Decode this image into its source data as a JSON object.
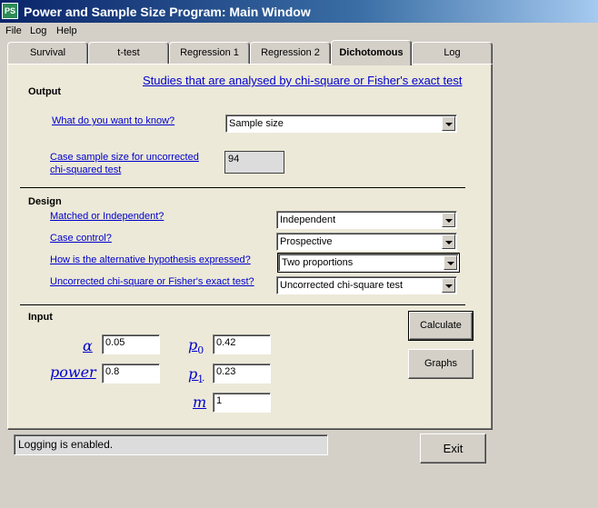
{
  "window": {
    "title": "Power and Sample Size Program:  Main Window",
    "app_icon_text": "PS"
  },
  "menu": [
    "File",
    "Log",
    "Help"
  ],
  "tabs": [
    "Survival",
    "t-test",
    "Regression 1",
    "Regression 2",
    "Dichotomous",
    "Log"
  ],
  "active_tab": "Dichotomous",
  "header_link": "Studies that are analysed by chi-square or Fisher's exact test",
  "output": {
    "heading": "Output",
    "question_label": "What do you want to know?",
    "question_value": "Sample size",
    "result_label_line1": "Case sample size for uncorrected",
    "result_label_line2": "chi-squared test",
    "result_value": "94"
  },
  "design": {
    "heading": "Design",
    "matched_label": "Matched or Independent?",
    "matched_value": "Independent",
    "case_control_label": "Case control?",
    "case_control_value": "Prospective",
    "alt_hyp_label": "How is the alternative hypothesis expressed?",
    "alt_hyp_value": "Two proportions",
    "test_label": "Uncorrected chi-square or Fisher's exact test?",
    "test_value": "Uncorrected chi-square test"
  },
  "input": {
    "heading": "Input",
    "alpha_label": "α",
    "alpha_value": "0.05",
    "power_label": "power",
    "power_value": "0.8",
    "p0_label": "p",
    "p0_sub": "0",
    "p0_value": "0.42",
    "p1_label": "p",
    "p1_sub": "1",
    "p1_value": "0.23",
    "m_label": "m",
    "m_value": "1"
  },
  "buttons": {
    "calculate": "Calculate",
    "graphs": "Graphs",
    "exit": "Exit"
  },
  "status": "Logging is enabled."
}
